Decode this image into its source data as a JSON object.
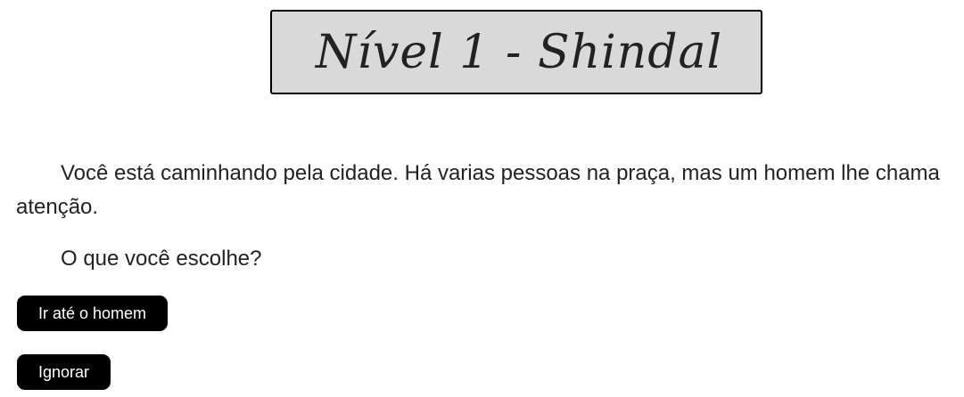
{
  "level_title": "Nível 1  - Shindal",
  "story": {
    "paragraph": "Você está caminhando pela cidade. Há varias pessoas na praça, mas um homem lhe chama atenção.",
    "prompt": "O que você escolhe?"
  },
  "choices": [
    {
      "label": "Ir até o homem"
    },
    {
      "label": "Ignorar"
    }
  ],
  "colors": {
    "title_background": "#d9d9d9",
    "button_background": "#000000",
    "button_text": "#ffffff",
    "text": "#222222"
  }
}
